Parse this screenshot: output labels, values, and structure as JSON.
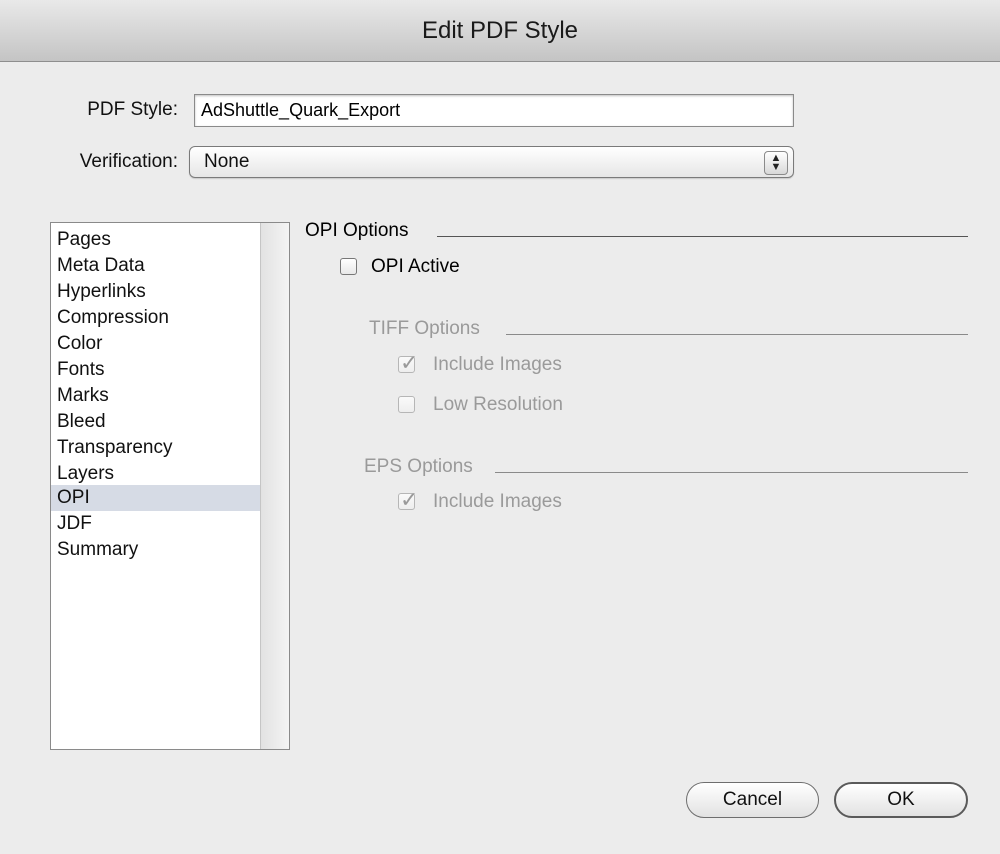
{
  "window": {
    "title": "Edit PDF Style"
  },
  "form": {
    "pdf_style_label": "PDF Style:",
    "pdf_style_value": "AdShuttle_Quark_Export",
    "verification_label": "Verification:",
    "verification_value": "None"
  },
  "sidebar": {
    "items": [
      {
        "label": "Pages"
      },
      {
        "label": "Meta Data"
      },
      {
        "label": "Hyperlinks"
      },
      {
        "label": "Compression"
      },
      {
        "label": "Color"
      },
      {
        "label": "Fonts"
      },
      {
        "label": "Marks"
      },
      {
        "label": "Bleed"
      },
      {
        "label": "Transparency"
      },
      {
        "label": "Layers"
      },
      {
        "label": "OPI"
      },
      {
        "label": "JDF"
      },
      {
        "label": "Summary"
      }
    ],
    "selected": "OPI"
  },
  "opi": {
    "title": "OPI Options",
    "active_label": "OPI Active",
    "active_checked": false,
    "tiff": {
      "title": "TIFF Options",
      "include_images_label": "Include Images",
      "include_images_checked": true,
      "low_resolution_label": "Low Resolution",
      "low_resolution_checked": false
    },
    "eps": {
      "title": "EPS Options",
      "include_images_label": "Include Images",
      "include_images_checked": true
    }
  },
  "buttons": {
    "cancel": "Cancel",
    "ok": "OK"
  }
}
